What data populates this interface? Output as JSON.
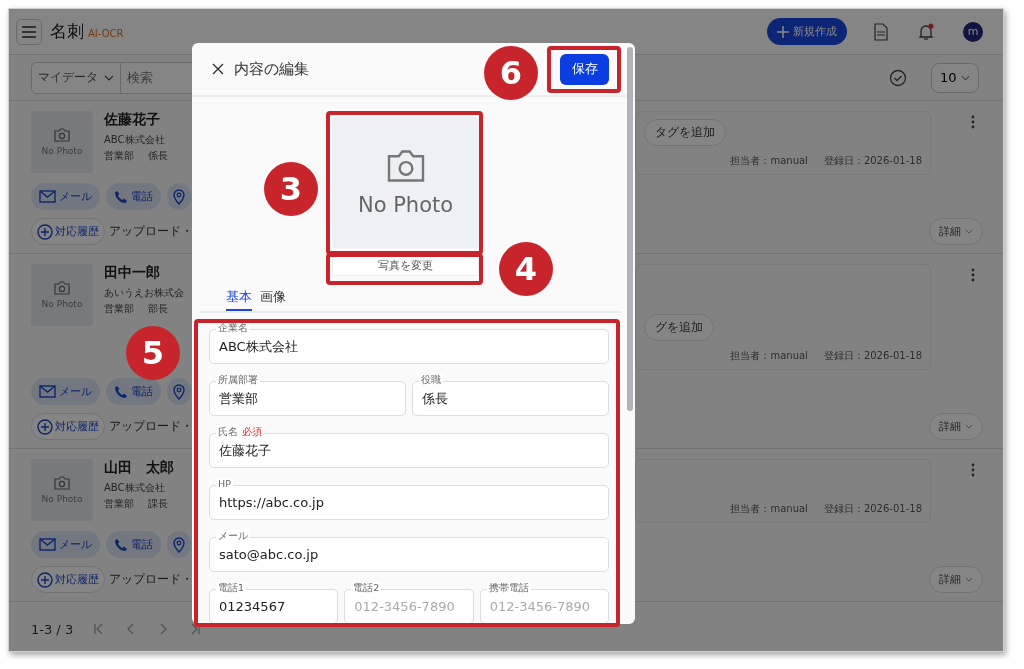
{
  "header": {
    "title": "名刺",
    "badge": "AI-OCR",
    "new_button": "新規作成",
    "avatar": "m",
    "notification": true
  },
  "toolbar": {
    "scope": "マイデータ",
    "search": {
      "placeholder": "検索"
    },
    "page_size": "10"
  },
  "cards": [
    {
      "photo": "No Photo",
      "name": "佐藤花子",
      "company": "ABC株式会社",
      "department": "営業部",
      "position": "係長",
      "actions": [
        "メール",
        "電話"
      ],
      "history": "対応履歴",
      "upload": "アップロード・",
      "tag": "タグを追加",
      "owner": "担当者：manual",
      "registered": "登録日：2026-01-18",
      "detail": "詳細"
    },
    {
      "photo": "No Photo",
      "name": "田中一郎",
      "company": "あいうえお株式会",
      "department": "営業部",
      "position": "部長",
      "actions": [
        "メール",
        "電話"
      ],
      "history": "対応履歴",
      "upload": "アップロード・",
      "tag": "グを追加",
      "owner": "担当者：manual",
      "registered": "登録日：2026-01-18",
      "detail": "詳細"
    },
    {
      "photo": "No Photo",
      "name": "山田　太郎",
      "company": "ABC株式会社",
      "department": "営業部",
      "position": "課長",
      "actions": [
        "メール",
        "電話"
      ],
      "history": "対応履歴",
      "upload": "アップロード・",
      "owner": "担当者：manual",
      "registered": "登録日：2026-01-18",
      "detail": "詳細"
    }
  ],
  "pagination": {
    "range": "1-3 / 3"
  },
  "editor": {
    "title": "内容の編集",
    "save": "保存",
    "photo": "No Photo",
    "change_photo": "写真を変更",
    "tabs": [
      {
        "label": "基本",
        "selected": true
      },
      {
        "label": "画像",
        "selected": false
      }
    ],
    "rows": [
      {
        "fields": [
          {
            "label": "企業名",
            "value": "ABC株式会社"
          }
        ]
      },
      {
        "fields": [
          {
            "label": "所属部署",
            "value": "営業部"
          },
          {
            "label": "役職",
            "value": "係長"
          }
        ]
      },
      {
        "fields": [
          {
            "label": "氏名",
            "badge": "必須",
            "value": "佐藤花子"
          }
        ]
      },
      {
        "fields": [
          {
            "label": "HP",
            "value": "https://abc.co.jp"
          }
        ]
      },
      {
        "fields": [
          {
            "label": "メール",
            "value": "sato@abc.co.jp"
          }
        ]
      },
      {
        "fields": [
          {
            "label": "電話1",
            "value": "01234567"
          },
          {
            "label": "電話2",
            "placeholder": "012-3456-7890"
          },
          {
            "label": "携帯電話",
            "placeholder": "012-3456-7890"
          }
        ]
      }
    ]
  },
  "annotations": [
    {
      "number": "6"
    },
    {
      "number": "3"
    },
    {
      "number": "4"
    },
    {
      "number": "5"
    }
  ]
}
